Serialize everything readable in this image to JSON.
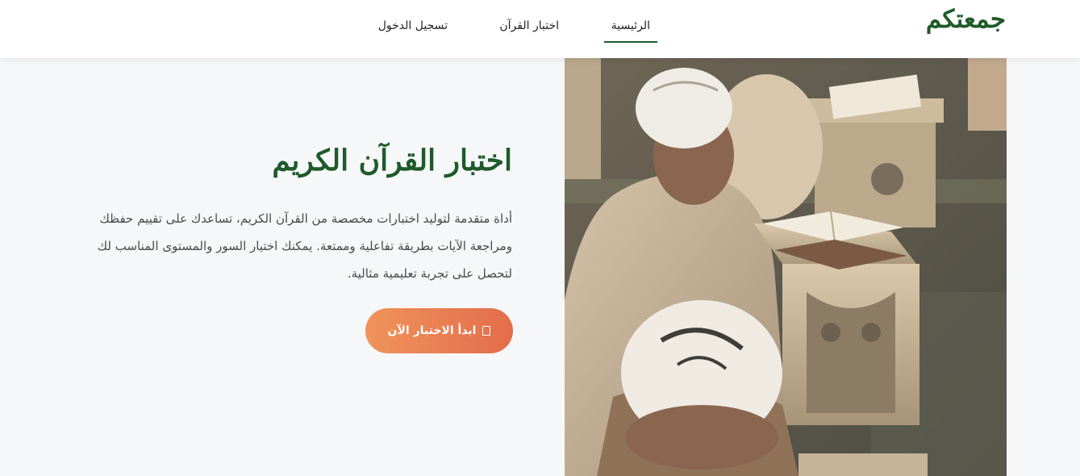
{
  "brand": {
    "logo": "جمعتكم",
    "primary_color": "#1f5a2a",
    "accent_gradient": [
      "#f0935a",
      "#e36d4b"
    ]
  },
  "nav": {
    "items": [
      {
        "label": "الرئيسية",
        "active": true
      },
      {
        "label": "اختبار القرآن",
        "active": false
      },
      {
        "label": "تسجيل الدخول",
        "active": false
      }
    ]
  },
  "hero": {
    "title": "اختبار القرآن الكريم",
    "description": "أداة متقدمة لتوليد اختبارات مخصصة من القرآن الكريم، تساعدك على تقييم حفظك ومراجعة الآيات بطريقة تفاعلية وممتعة. يمكنك اختيار السور والمستوى المناسب لك لتحصل على تجربة تعليمية مثالية.",
    "cta_label": "ابدأ الاختبار الآن",
    "cta_icon": "document-icon",
    "image_icon": "photo-students-reading-quran"
  }
}
